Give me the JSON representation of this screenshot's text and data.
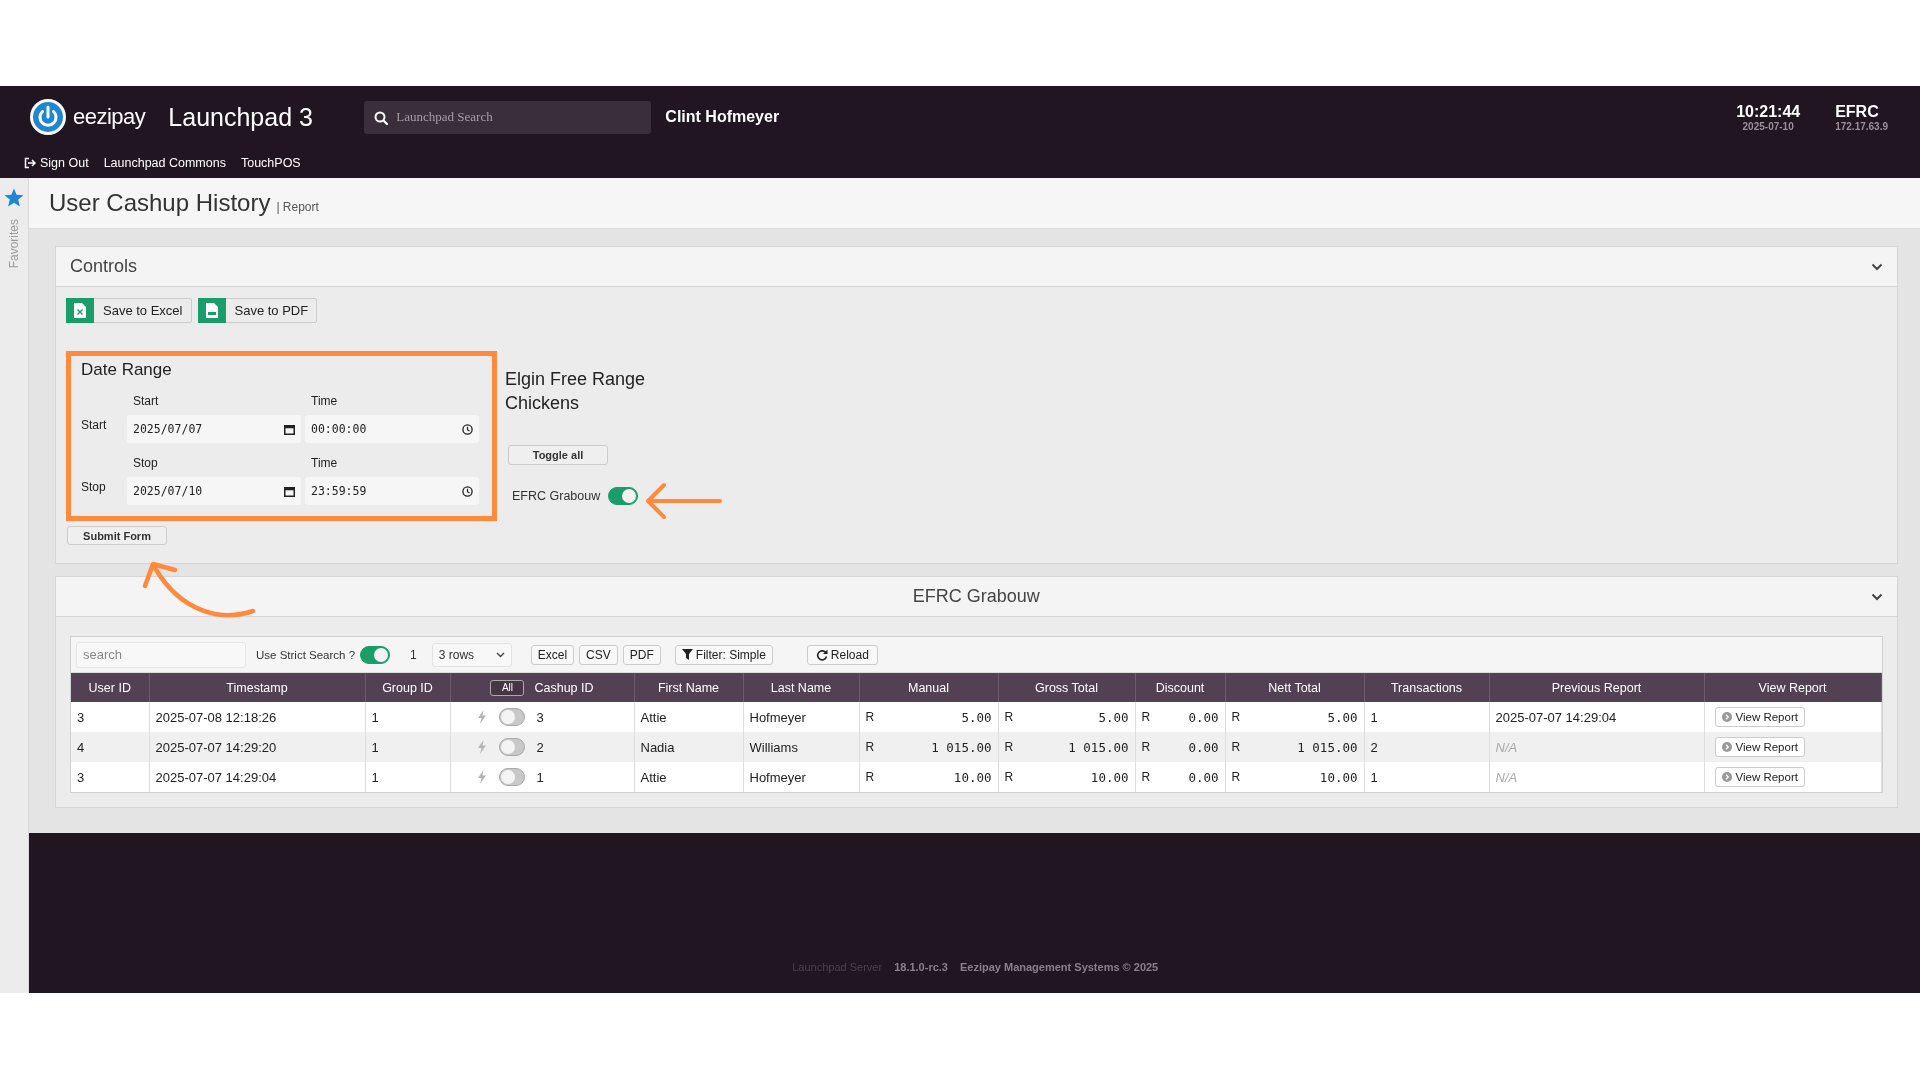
{
  "header": {
    "brand": "eezipay",
    "app_title": "Launchpad 3",
    "search": {
      "placeholder": "Launchpad Search"
    },
    "user": "Clint Hofmeyer",
    "time": "10:21:44",
    "date": "2025-07-10",
    "site": "EFRC",
    "ip": "172.17.63.9",
    "nav": [
      {
        "label": "Sign Out",
        "kind": "signout"
      },
      {
        "label": "Launchpad Commons",
        "kind": "link"
      },
      {
        "label": "TouchPOS",
        "kind": "link"
      }
    ]
  },
  "sidebar": {
    "label": "Favorites"
  },
  "page": {
    "title": "User Cashup History",
    "subtitle": "| Report"
  },
  "controls": {
    "title": "Controls",
    "expanded": true,
    "buttons": [
      {
        "label": "Save to Excel",
        "kind": "excel"
      },
      {
        "label": "Save to PDF",
        "kind": "pdf"
      }
    ],
    "date_range": {
      "title": "Date Range",
      "rows": [
        {
          "label": "Start",
          "date_label": "Start",
          "time_label": "Time",
          "date": "2025/07/07",
          "time": "00:00:00"
        },
        {
          "label": "Stop",
          "date_label": "Stop",
          "time_label": "Time",
          "date": "2025/07/10",
          "time": "23:59:59"
        }
      ]
    },
    "submit": "Submit Form",
    "group": {
      "title": "Elgin Free Range Chickens",
      "toggle_all": "Toggle all",
      "branches": [
        {
          "name": "EFRC Grabouw",
          "on": true
        }
      ]
    }
  },
  "report": {
    "title": "EFRC Grabouw",
    "expanded": true,
    "toolbar": {
      "search": {
        "placeholder": "search"
      },
      "strict_label": "Use Strict Search ?",
      "strict_on": true,
      "page": "1",
      "rows_select": "3 rows",
      "exports": [
        "Excel",
        "CSV",
        "PDF"
      ],
      "filter": "Filter: Simple",
      "reload": "Reload"
    },
    "columns": [
      {
        "label": "User ID"
      },
      {
        "label": "Timestamp"
      },
      {
        "label": "Group ID"
      },
      {
        "label": "Cashup ID",
        "button": "All"
      },
      {
        "label": "First Name"
      },
      {
        "label": "Last Name"
      },
      {
        "label": "Manual"
      },
      {
        "label": "Gross Total"
      },
      {
        "label": "Discount"
      },
      {
        "label": "Nett Total"
      },
      {
        "label": "Transactions"
      },
      {
        "label": "Previous Report"
      },
      {
        "label": "View Report"
      }
    ],
    "rows": [
      {
        "user_id": "3",
        "timestamp": "2025-07-08 12:18:26",
        "group_id": "1",
        "selected": false,
        "cashup_id": "3",
        "first_name": "Attie",
        "last_name": "Hofmeyer",
        "manual": {
          "currency": "R",
          "amount": "5.00"
        },
        "gross_total": {
          "currency": "R",
          "amount": "5.00"
        },
        "discount": {
          "currency": "R",
          "amount": "0.00"
        },
        "nett_total": {
          "currency": "R",
          "amount": "5.00"
        },
        "transactions": "1",
        "previous_report": "2025-07-07 14:29:04",
        "has_previous": true,
        "action": "View Report"
      },
      {
        "user_id": "4",
        "timestamp": "2025-07-07 14:29:20",
        "group_id": "1",
        "selected": false,
        "cashup_id": "2",
        "first_name": "Nadia",
        "last_name": "Williams",
        "manual": {
          "currency": "R",
          "amount": "1 015.00"
        },
        "gross_total": {
          "currency": "R",
          "amount": "1 015.00"
        },
        "discount": {
          "currency": "R",
          "amount": "0.00"
        },
        "nett_total": {
          "currency": "R",
          "amount": "1 015.00"
        },
        "transactions": "2",
        "previous_report": "N/A",
        "has_previous": false,
        "action": "View Report"
      },
      {
        "user_id": "3",
        "timestamp": "2025-07-07 14:29:04",
        "group_id": "1",
        "selected": false,
        "cashup_id": "1",
        "first_name": "Attie",
        "last_name": "Hofmeyer",
        "manual": {
          "currency": "R",
          "amount": "10.00"
        },
        "gross_total": {
          "currency": "R",
          "amount": "10.00"
        },
        "discount": {
          "currency": "R",
          "amount": "0.00"
        },
        "nett_total": {
          "currency": "R",
          "amount": "10.00"
        },
        "transactions": "1",
        "previous_report": "N/A",
        "has_previous": false,
        "action": "View Report"
      }
    ]
  },
  "footer": {
    "server_label": "Launchpad Server",
    "version": "18.1.0-rc.3",
    "copyright": "Eezipay Management Systems © 2025"
  }
}
